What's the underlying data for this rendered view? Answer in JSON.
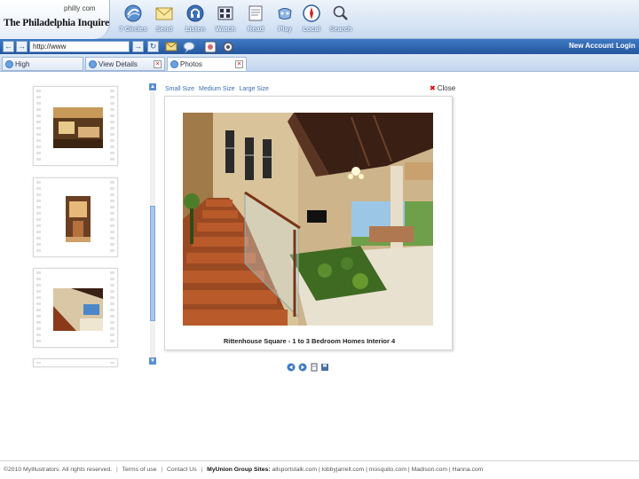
{
  "header": {
    "logo_small": "philly com",
    "logo_title": "The Philadelphia Inquirer",
    "tools": [
      {
        "label": "7 Circles",
        "icon": "circles-icon"
      },
      {
        "label": "Send",
        "icon": "envelope-icon"
      },
      {
        "label": "Listen",
        "icon": "listen-icon"
      },
      {
        "label": "Watch",
        "icon": "watch-icon"
      },
      {
        "label": "Read",
        "icon": "read-icon"
      },
      {
        "label": "Play",
        "icon": "play-icon"
      },
      {
        "label": "Local",
        "icon": "compass-icon"
      },
      {
        "label": "Search",
        "icon": "magnifier-icon"
      }
    ]
  },
  "addressbar": {
    "url": "http://www",
    "new_account": "New Account",
    "login": "Login"
  },
  "tabs": [
    {
      "label": "High",
      "active": false
    },
    {
      "label": "View Details",
      "active": false
    },
    {
      "label": "Photos",
      "active": true
    }
  ],
  "viewer": {
    "size_links": [
      "Small Size",
      "Medium Size",
      "Large Size"
    ],
    "close_label": "Close",
    "caption": "Rittenhouse Square - 1 to 3 Bedroom Homes Interior 4"
  },
  "footer": {
    "copyright": "©2010 MyIllustrators. All rights reserved.",
    "terms": "Terms of use",
    "contact": "Contact Us",
    "group_label": "MyUnion Group Sites:",
    "sites": "allsportstalk.com | lobbyjarrell.com | mosquito.com | Madison.com | Hanna.com"
  },
  "colors": {
    "toolbar_top": "#eef4fb",
    "toolbar_bottom": "#c9dbf0",
    "addressbar": "#2d62ab",
    "link": "#3b6db3",
    "close_x": "#dd0000"
  }
}
